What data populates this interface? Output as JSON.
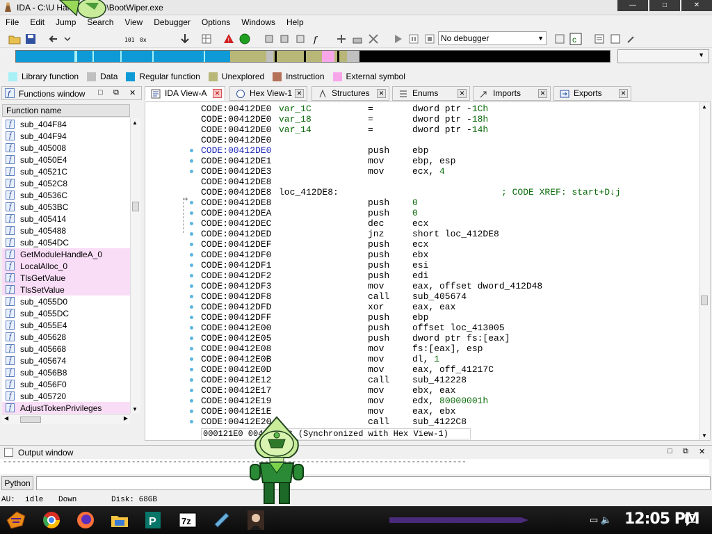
{
  "window": {
    "title": "IDA - C:\\U         Hale\\Desktop\\BootWiper.exe",
    "min": "—",
    "max": "□",
    "close": "✕"
  },
  "menu": [
    "File",
    "Edit",
    "Jump",
    "Search",
    "View",
    "Debugger",
    "Options",
    "Windows",
    "Help"
  ],
  "toolbar": {
    "debugger_select": "No debugger"
  },
  "legend": [
    {
      "label": "Library function",
      "color": "#a6f0f6"
    },
    {
      "label": "Data",
      "color": "#c0c0c0"
    },
    {
      "label": "Regular function",
      "color": "#0e9ad6"
    },
    {
      "label": "Unexplored",
      "color": "#b8b778"
    },
    {
      "label": "Instruction",
      "color": "#b57058"
    },
    {
      "label": "External symbol",
      "color": "#f7a6ea"
    }
  ],
  "functions_window": {
    "title": "Functions window",
    "column_header": "Function name",
    "items": [
      {
        "name": "sub_404F84",
        "imported": false
      },
      {
        "name": "sub_404F94",
        "imported": false
      },
      {
        "name": "sub_405008",
        "imported": false
      },
      {
        "name": "sub_4050E4",
        "imported": false
      },
      {
        "name": "sub_40521C",
        "imported": false
      },
      {
        "name": "sub_4052C8",
        "imported": false
      },
      {
        "name": "sub_40536C",
        "imported": false
      },
      {
        "name": "sub_4053BC",
        "imported": false
      },
      {
        "name": "sub_405414",
        "imported": false
      },
      {
        "name": "sub_405488",
        "imported": false
      },
      {
        "name": "sub_4054DC",
        "imported": false
      },
      {
        "name": "GetModuleHandleA_0",
        "imported": true
      },
      {
        "name": "LocalAlloc_0",
        "imported": true
      },
      {
        "name": "TlsGetValue",
        "imported": true
      },
      {
        "name": "TlsSetValue",
        "imported": true
      },
      {
        "name": "sub_4055D0",
        "imported": false
      },
      {
        "name": "sub_4055DC",
        "imported": false
      },
      {
        "name": "sub_4055E4",
        "imported": false
      },
      {
        "name": "sub_405628",
        "imported": false
      },
      {
        "name": "sub_405668",
        "imported": false
      },
      {
        "name": "sub_405674",
        "imported": false
      },
      {
        "name": "sub_4056B8",
        "imported": false
      },
      {
        "name": "sub_4056F0",
        "imported": false
      },
      {
        "name": "sub_405720",
        "imported": false
      },
      {
        "name": "AdjustTokenPrivileges",
        "imported": true
      }
    ]
  },
  "tabs": [
    {
      "label": "IDA View-A",
      "active": true
    },
    {
      "label": "Hex View-1",
      "active": false
    },
    {
      "label": "Structures",
      "active": false
    },
    {
      "label": "Enums",
      "active": false
    },
    {
      "label": "Imports",
      "active": false
    },
    {
      "label": "Exports",
      "active": false
    }
  ],
  "disassembly": [
    {
      "addr": "CODE:00412DE0",
      "label": "var_1C",
      "var": true,
      "mn": "=",
      "op": "dword ptr -1Ch",
      "cmt": ""
    },
    {
      "addr": "CODE:00412DE0",
      "label": "var_18",
      "var": true,
      "mn": "=",
      "op": "dword ptr -18h",
      "cmt": ""
    },
    {
      "addr": "CODE:00412DE0",
      "label": "var_14",
      "var": true,
      "mn": "=",
      "op": "dword ptr -14h",
      "cmt": ""
    },
    {
      "addr": "CODE:00412DE0",
      "label": "",
      "mn": "",
      "op": "",
      "cmt": ""
    },
    {
      "addr": "CODE:00412DE0",
      "label": "",
      "mn": "push",
      "op": "ebp",
      "cmt": "",
      "cur": true,
      "dot": true
    },
    {
      "addr": "CODE:00412DE1",
      "label": "",
      "mn": "mov",
      "op": "ebp, esp",
      "cmt": "",
      "dot": true
    },
    {
      "addr": "CODE:00412DE3",
      "label": "",
      "mn": "mov",
      "op": "ecx, 4",
      "cmt": "",
      "dot": true
    },
    {
      "addr": "CODE:00412DE8",
      "label": "",
      "mn": "",
      "op": "",
      "cmt": ""
    },
    {
      "addr": "CODE:00412DE8",
      "label": "loc_412DE8:",
      "mn": "",
      "op": "",
      "cmt": "; CODE XREF: start+D↓j"
    },
    {
      "addr": "CODE:00412DE8",
      "label": "",
      "mn": "push",
      "op": "0",
      "cmt": "",
      "dot": true
    },
    {
      "addr": "CODE:00412DEA",
      "label": "",
      "mn": "push",
      "op": "0",
      "cmt": "",
      "dot": true
    },
    {
      "addr": "CODE:00412DEC",
      "label": "",
      "mn": "dec",
      "op": "ecx",
      "cmt": "",
      "dot": true
    },
    {
      "addr": "CODE:00412DED",
      "label": "",
      "mn": "jnz",
      "op": "short loc_412DE8",
      "cmt": "",
      "dot": true
    },
    {
      "addr": "CODE:00412DEF",
      "label": "",
      "mn": "push",
      "op": "ecx",
      "cmt": "",
      "dot": true
    },
    {
      "addr": "CODE:00412DF0",
      "label": "",
      "mn": "push",
      "op": "ebx",
      "cmt": "",
      "dot": true
    },
    {
      "addr": "CODE:00412DF1",
      "label": "",
      "mn": "push",
      "op": "esi",
      "cmt": "",
      "dot": true
    },
    {
      "addr": "CODE:00412DF2",
      "label": "",
      "mn": "push",
      "op": "edi",
      "cmt": "",
      "dot": true
    },
    {
      "addr": "CODE:00412DF3",
      "label": "",
      "mn": "mov",
      "op": "eax, offset dword_412D48",
      "cmt": "",
      "dot": true
    },
    {
      "addr": "CODE:00412DF8",
      "label": "",
      "mn": "call",
      "op": "sub_405674",
      "cmt": "",
      "dot": true
    },
    {
      "addr": "CODE:00412DFD",
      "label": "",
      "mn": "xor",
      "op": "eax, eax",
      "cmt": "",
      "dot": true
    },
    {
      "addr": "CODE:00412DFF",
      "label": "",
      "mn": "push",
      "op": "ebp",
      "cmt": "",
      "dot": true
    },
    {
      "addr": "CODE:00412E00",
      "label": "",
      "mn": "push",
      "op": "offset loc_413005",
      "cmt": "",
      "dot": true
    },
    {
      "addr": "CODE:00412E05",
      "label": "",
      "mn": "push",
      "op": "dword ptr fs:[eax]",
      "cmt": "",
      "dot": true
    },
    {
      "addr": "CODE:00412E08",
      "label": "",
      "mn": "mov",
      "op": "fs:[eax], esp",
      "cmt": "",
      "dot": true
    },
    {
      "addr": "CODE:00412E0B",
      "label": "",
      "mn": "mov",
      "op": "dl, 1",
      "cmt": "",
      "dot": true
    },
    {
      "addr": "CODE:00412E0D",
      "label": "",
      "mn": "mov",
      "op": "eax, off_41217C",
      "cmt": "",
      "dot": true
    },
    {
      "addr": "CODE:00412E12",
      "label": "",
      "mn": "call",
      "op": "sub_412228",
      "cmt": "",
      "dot": true
    },
    {
      "addr": "CODE:00412E17",
      "label": "",
      "mn": "mov",
      "op": "ebx, eax",
      "cmt": "",
      "dot": true
    },
    {
      "addr": "CODE:00412E19",
      "label": "",
      "mn": "mov",
      "op": "edx, 80000001h",
      "cmt": "",
      "dot": true
    },
    {
      "addr": "CODE:00412E1E",
      "label": "",
      "mn": "mov",
      "op": "eax, ebx",
      "cmt": "",
      "dot": true
    },
    {
      "addr": "CODE:00412E20",
      "label": "",
      "mn": "call",
      "op": "sub_4122C8",
      "cmt": "",
      "dot": true
    }
  ],
  "disasm_status": "000121E0 004         start (Synchronized with Hex View-1)",
  "output_window": {
    "title": "Output window",
    "text": "-----------------------------------------------------------------------------------------------------",
    "python_button": "Python"
  },
  "statusbar": {
    "au_label": "AU:",
    "au_state": "idle",
    "direction": "Down",
    "disk": "Disk: 68GB"
  },
  "taskbar": {
    "clock": "12:05 PM"
  }
}
